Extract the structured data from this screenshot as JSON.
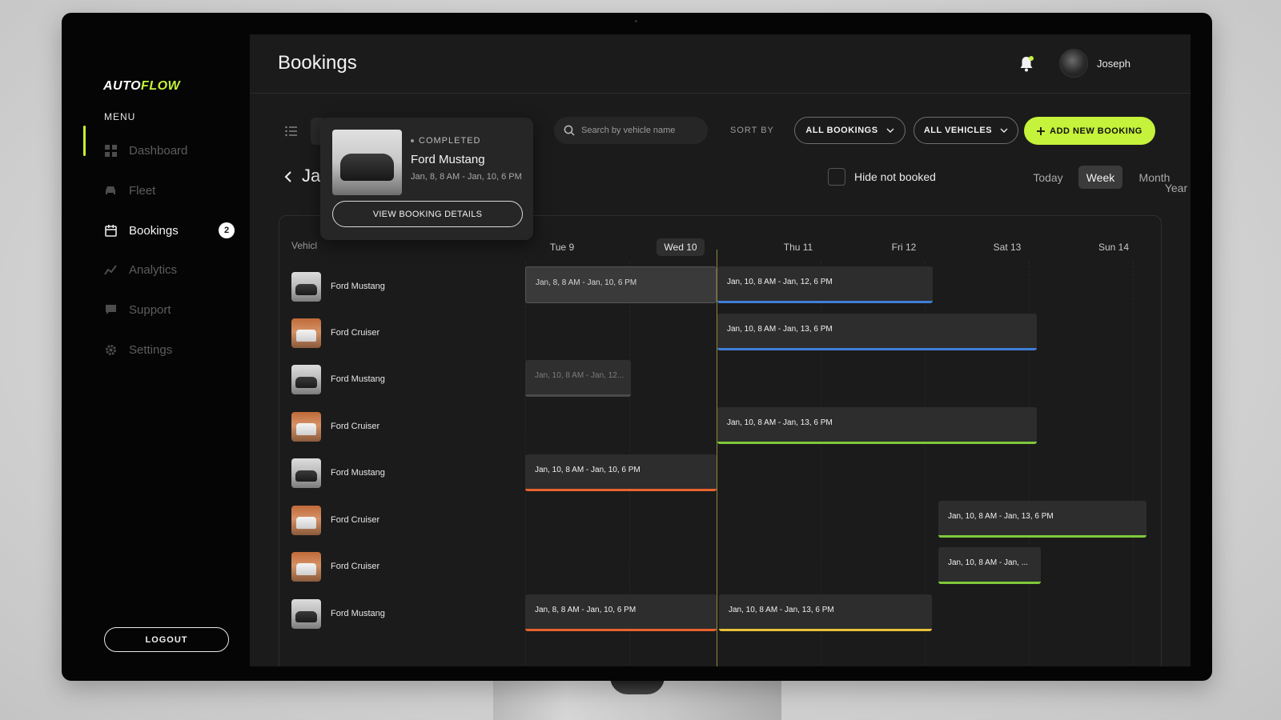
{
  "app": {
    "logo_main": "AUTO",
    "logo_accent": "FLOW"
  },
  "sidebar": {
    "menu_label": "MENU",
    "items": [
      {
        "label": "Dashboard",
        "icon": "grid-icon"
      },
      {
        "label": "Fleet",
        "icon": "car-icon"
      },
      {
        "label": "Bookings",
        "icon": "calendar-icon",
        "badge": "2"
      },
      {
        "label": "Analytics",
        "icon": "chart-icon"
      },
      {
        "label": "Support",
        "icon": "chat-icon"
      },
      {
        "label": "Settings",
        "icon": "gear-icon"
      }
    ],
    "logout_label": "LOGOUT"
  },
  "header": {
    "title": "Bookings",
    "user_name": "Joseph"
  },
  "toolbar": {
    "search_placeholder": "Search by vehicle name",
    "sort_label": "SORT BY",
    "bookings_filter": "ALL BOOKINGS",
    "vehicles_filter": "ALL VEHICLES",
    "add_button": "ADD NEW BOOKING"
  },
  "calendar_nav": {
    "month_title": "Ja",
    "hide_label": "Hide not booked",
    "views": [
      "Today",
      "Week",
      "Month",
      "Year"
    ],
    "active_view": "Week"
  },
  "calendar": {
    "vehicles_header": "Vehicl",
    "days": [
      "Tue 9",
      "Wed 10",
      "Thu 11",
      "Fri 12",
      "Sat 13",
      "Sun 14"
    ],
    "today": "Wed 10",
    "vehicles": [
      "Ford Mustang",
      "Ford Cruiser",
      "Ford Mustang",
      "Ford Cruiser",
      "Ford Mustang",
      "Ford Cruiser",
      "Ford Cruiser",
      "Ford Mustang"
    ],
    "bookings": [
      {
        "label": "Jan, 8, 8 AM - Jan, 10, 6 PM",
        "status": "completed"
      },
      {
        "label": "Jan, 10, 8 AM - Jan, 12, 6 PM",
        "color": "#3f7fd6"
      },
      {
        "label": "Jan, 10, 8 AM - Jan, 13, 6 PM",
        "color": "#3f7fd6"
      },
      {
        "label": "Jan, 10, 8 AM - Jan, 12...",
        "status": "muted"
      },
      {
        "label": "Jan, 10, 8 AM - Jan, 13, 6 PM",
        "color": "#7ec83a"
      },
      {
        "label": "Jan, 10, 8 AM - Jan, 10, 6 PM",
        "color": "#e8632e"
      },
      {
        "label": "Jan, 10, 8 AM - Jan, 13, 6 PM",
        "color": "#7ec83a"
      },
      {
        "label": "Jan, 10, 8 AM - Jan, ...",
        "color": "#7ec83a"
      },
      {
        "label": "Jan, 8, 8 AM - Jan, 10, 6 PM",
        "color": "#e8632e"
      },
      {
        "label": "Jan, 10, 8 AM - Jan, 13, 6 PM",
        "color": "#e8c23a"
      }
    ]
  },
  "popover": {
    "status": "COMPLETED",
    "title": "Ford Mustang",
    "range": "Jan, 8, 8 AM - Jan, 10, 6 PM",
    "button": "VIEW BOOKING DETAILS"
  },
  "colors": {
    "accent": "#c5f23a",
    "blue": "#3f7fd6",
    "green": "#7ec83a",
    "orange": "#e8632e",
    "yellow": "#e8c23a"
  }
}
